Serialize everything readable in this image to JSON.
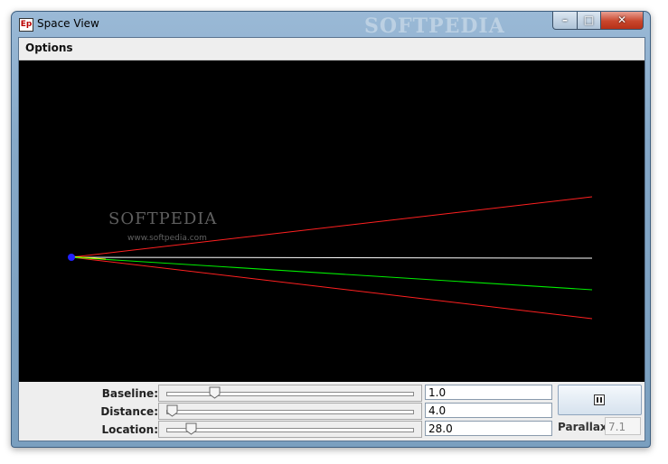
{
  "window": {
    "title": "Space View",
    "icon_text": "Ep",
    "watermark": "SOFTPEDIA",
    "minimize_glyph": "–",
    "maximize_glyph": "□",
    "close_glyph": "✕"
  },
  "menu": {
    "items": [
      "Options"
    ]
  },
  "canvas": {
    "watermark": "SOFTPEDIA",
    "watermark_url": "www.softpedia.com",
    "colors": {
      "background": "#000000",
      "upper_ray": "#ff2020",
      "lower_ray": "#ff2020",
      "baseline_ray": "#ffffff",
      "sight_ray": "#00ee00",
      "observer": "#2222ff"
    }
  },
  "controls": {
    "baseline": {
      "label": "Baseline:",
      "value": "1.0",
      "slider_fraction": 0.18
    },
    "distance": {
      "label": "Distance:",
      "value": "4.0",
      "slider_fraction": 0.0
    },
    "location": {
      "label": "Location:",
      "value": "28.0",
      "slider_fraction": 0.08
    },
    "pause_icon": "pause-icon",
    "parallax": {
      "label": "Parallax:",
      "value": "7.1"
    }
  }
}
